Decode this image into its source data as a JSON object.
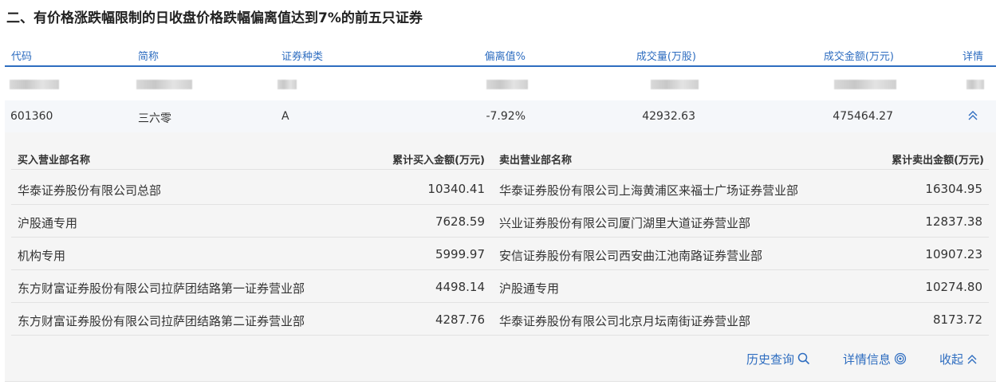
{
  "title": "二、有价格涨跌幅限制的日收盘价格跌幅偏离值达到7%的前五只证券",
  "table": {
    "headers": {
      "code": "代码",
      "name": "简称",
      "type": "证券种类",
      "deviation": "偏离值%",
      "volume": "成交量(万股)",
      "amount": "成交金额(万元)",
      "detail": "详情"
    },
    "row": {
      "code": "601360",
      "name": "三六零",
      "type": "A",
      "deviation": "-7.92%",
      "volume": "42932.63",
      "amount": "475464.27"
    }
  },
  "detail": {
    "headers": {
      "buy_name": "买入营业部名称",
      "buy_amount": "累计买入金额(万元)",
      "sell_name": "卖出营业部名称",
      "sell_amount": "累计卖出金额(万元)"
    },
    "rows": [
      {
        "buy_name": "华泰证券股份有限公司总部",
        "buy_amount": "10340.41",
        "sell_name": "华泰证券股份有限公司上海黄浦区来福士广场证券营业部",
        "sell_amount": "16304.95"
      },
      {
        "buy_name": "沪股通专用",
        "buy_amount": "7628.59",
        "sell_name": "兴业证券股份有限公司厦门湖里大道证券营业部",
        "sell_amount": "12837.38"
      },
      {
        "buy_name": "机构专用",
        "buy_amount": "5999.97",
        "sell_name": "安信证券股份有限公司西安曲江池南路证券营业部",
        "sell_amount": "10907.23"
      },
      {
        "buy_name": "东方财富证券股份有限公司拉萨团结路第一证券营业部",
        "buy_amount": "4498.14",
        "sell_name": "沪股通专用",
        "sell_amount": "10274.80"
      },
      {
        "buy_name": "东方财富证券股份有限公司拉萨团结路第二证券营业部",
        "buy_amount": "4287.76",
        "sell_name": "华泰证券股份有限公司北京月坛南街证券营业部",
        "sell_amount": "8173.72"
      }
    ]
  },
  "footer": {
    "history": "历史查询",
    "info": "详情信息",
    "collapse": "收起"
  },
  "icons": {
    "history": "search-icon",
    "info": "target-icon",
    "collapse": "double-chevron-up-icon"
  },
  "colors": {
    "accent": "#2e6dc0"
  }
}
